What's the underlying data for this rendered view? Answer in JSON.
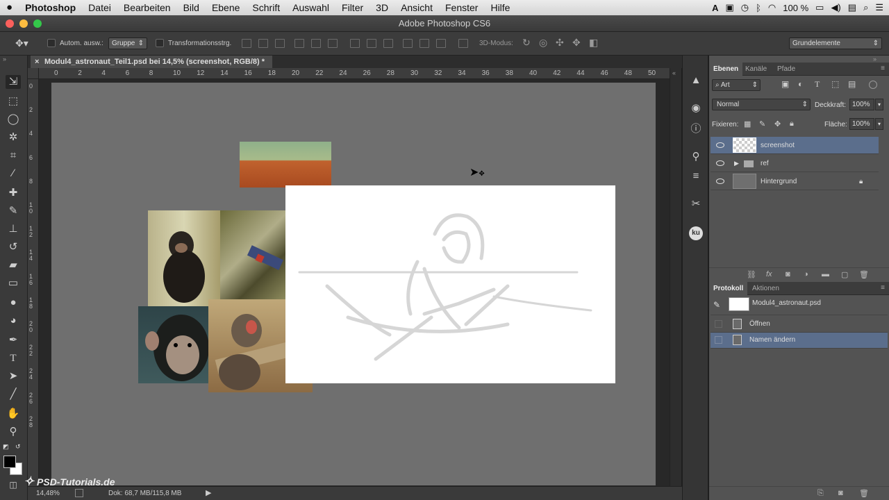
{
  "menubar": {
    "apple": "",
    "app_name": "Photoshop",
    "items": [
      "Datei",
      "Bearbeiten",
      "Bild",
      "Ebene",
      "Schrift",
      "Auswahl",
      "Filter",
      "3D",
      "Ansicht",
      "Fenster",
      "Hilfe"
    ],
    "battery": "100 %"
  },
  "window": {
    "title": "Adobe Photoshop CS6"
  },
  "options_bar": {
    "auto_select_label": "Autom. ausw.:",
    "auto_select_value": "Gruppe",
    "transform_label": "Transformationsstrg.",
    "mode_3d_label": "3D-Modus:",
    "workspace": "Grundelemente"
  },
  "document": {
    "tab_title": "Modul4_astronaut_Teil1.psd bei 14,5% (screenshot, RGB/8) *",
    "close": "×"
  },
  "rulers": {
    "horizontal": [
      "0",
      "2",
      "4",
      "6",
      "8",
      "10",
      "12",
      "14",
      "16",
      "18",
      "20",
      "22",
      "24",
      "26",
      "28",
      "30",
      "32",
      "34",
      "36",
      "38",
      "40",
      "42",
      "44",
      "46",
      "48",
      "50"
    ],
    "vertical": [
      "0",
      "2",
      "4",
      "6",
      "8",
      "10",
      "12",
      "14",
      "16",
      "18",
      "20",
      "22",
      "24",
      "26",
      "28"
    ]
  },
  "status": {
    "zoom": "14,48%",
    "doc_info": "Dok: 68,7 MB/115,8 MB"
  },
  "watermark": "PSD-Tutorials.de",
  "layers_panel": {
    "tabs": [
      "Ebenen",
      "Kanäle",
      "Pfade"
    ],
    "filter": "Art",
    "blend_mode": "Normal",
    "opacity_label": "Deckkraft:",
    "opacity_value": "100%",
    "lock_label": "Fixieren:",
    "fill_label": "Fläche:",
    "fill_value": "100%",
    "layers": [
      {
        "name": "screenshot",
        "selected": true
      },
      {
        "name": "ref",
        "selected": false
      },
      {
        "name": "Hintergrund",
        "selected": false
      }
    ]
  },
  "history_panel": {
    "tabs": [
      "Protokoll",
      "Aktionen"
    ],
    "snapshot": "Modul4_astronaut.psd",
    "steps": [
      {
        "name": "Öffnen",
        "selected": false
      },
      {
        "name": "Namen ändern",
        "selected": true
      }
    ]
  },
  "colors": {
    "accent": "#5b6e8c",
    "doc_bg": "#6f6f6f",
    "panel": "#535353"
  }
}
